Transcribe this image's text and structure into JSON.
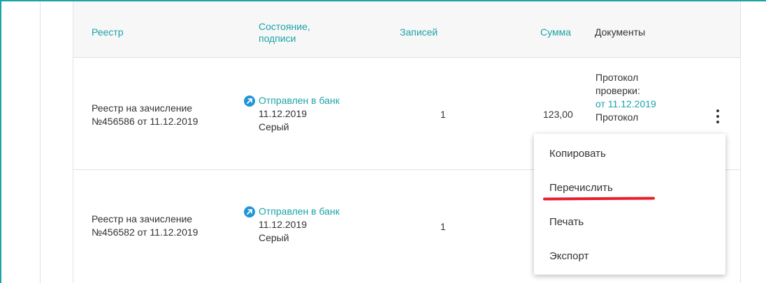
{
  "table": {
    "headers": {
      "registry": "Реестр",
      "state": "Состояние,\nподписи",
      "records": "Записей",
      "sum": "Сумма",
      "documents": "Документы"
    },
    "rows": [
      {
        "registry_line1": "Реестр на зачисление",
        "registry_line2": "№456586 от 11.12.2019",
        "status": "Отправлен в банк",
        "date": "11.12.2019",
        "signer": "Серый",
        "records": "1",
        "sum": "123,00",
        "doc_line1": "Протокол",
        "doc_line2": "проверки:",
        "doc_link": "от 11.12.2019",
        "doc_line3": "Протокол"
      },
      {
        "registry_line1": "Реестр на зачисление",
        "registry_line2": "№456582 от 11.12.2019",
        "status": "Отправлен в банк",
        "date": "11.12.2019",
        "signer": "Серый",
        "records": "1"
      }
    ]
  },
  "context_menu": {
    "items": [
      "Копировать",
      "Перечислить",
      "Печать",
      "Экспорт"
    ]
  },
  "colors": {
    "accent": "#1aa3a8",
    "status_icon": "#2196d6",
    "highlight_underline": "#e81d2b"
  },
  "icons": {
    "status": "arrow-up-right-icon",
    "row_menu": "kebab-menu-icon"
  }
}
